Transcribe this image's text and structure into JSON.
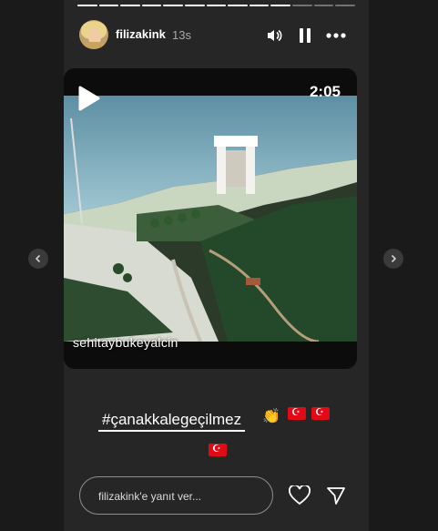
{
  "story": {
    "progress_segments": 13,
    "progress_done": 10,
    "username": "filizakink",
    "time": "13s",
    "icons": [
      "speaker-icon",
      "pause-icon",
      "more-icon",
      "chevron-left-icon",
      "chevron-right-icon",
      "heart-icon",
      "send-icon",
      "play-icon"
    ]
  },
  "video": {
    "duration": "2:05",
    "watermark": "sehitaybukeyalcin"
  },
  "sticker": {
    "hashtag": "#çanakkalegeçilmez",
    "emoji_clap": "👏"
  },
  "reply": {
    "placeholder": "filizakink'e yanıt ver..."
  },
  "colors": {
    "background": "#1a1a1a",
    "story_bg": "#262626",
    "flag_red": "#e30a17"
  }
}
